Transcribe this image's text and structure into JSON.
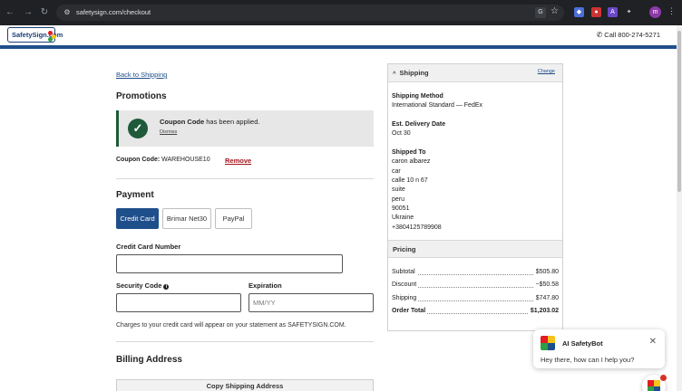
{
  "browser": {
    "url": "safetysign.com/checkout",
    "profile_initial": "m",
    "translate_label": "G"
  },
  "header": {
    "logo_text": "SafetySign.com",
    "phone": "Call 800-274-5271",
    "colors": {
      "brand_blue": "#1f4f8a",
      "danger_red": "#a4151c",
      "success_green": "#1f5a3a"
    }
  },
  "checkout": {
    "back_link": "Back to Shipping",
    "promotions": {
      "heading": "Promotions",
      "message_bold": "Coupon Code",
      "message_rest": " has been applied.",
      "dismiss": "Dismiss",
      "code_label": "Coupon Code:",
      "code_value": " WAREHOUSE10",
      "remove": "Remove"
    },
    "payment": {
      "heading": "Payment",
      "tabs": [
        {
          "label": "Credit Card",
          "active": true
        },
        {
          "label": "Brimar Net30",
          "active": false
        },
        {
          "label": "PayPal",
          "active": false
        }
      ],
      "card_number_label": "Credit Card Number",
      "card_number_value": "",
      "security_label": "Security Code",
      "security_value": "",
      "expiration_label": "Expiration",
      "expiration_placeholder": "MM/YY",
      "charges_note": "Charges to your credit card will appear on your statement as SAFETYSIGN.COM."
    },
    "billing": {
      "heading": "Billing Address",
      "copy_button": "Copy Shipping Address"
    }
  },
  "summary": {
    "shipping_title": "Shipping",
    "change_link": "Change",
    "method_label": "Shipping Method",
    "method_value": "International Standard — FedEx",
    "delivery_label": "Est. Delivery Date",
    "delivery_value": "Oct 30",
    "shipped_to_label": "Shipped To",
    "address_lines": [
      "caron albarez",
      "car",
      "calle 10 n 67",
      "suite",
      "peru",
      "90051",
      "Ukraine",
      "+3804125789908"
    ],
    "pricing_title": "Pricing",
    "rows": [
      {
        "label": "Subtotal",
        "amount": "$505.80"
      },
      {
        "label": "Discount",
        "amount": "−$50.58"
      },
      {
        "label": "Shipping",
        "amount": "$747.80"
      },
      {
        "label": "Order Total",
        "amount": "$1,203.02"
      }
    ]
  },
  "chat": {
    "title": "AI SafetyBot",
    "message": "Hey there, how can I help you?"
  }
}
